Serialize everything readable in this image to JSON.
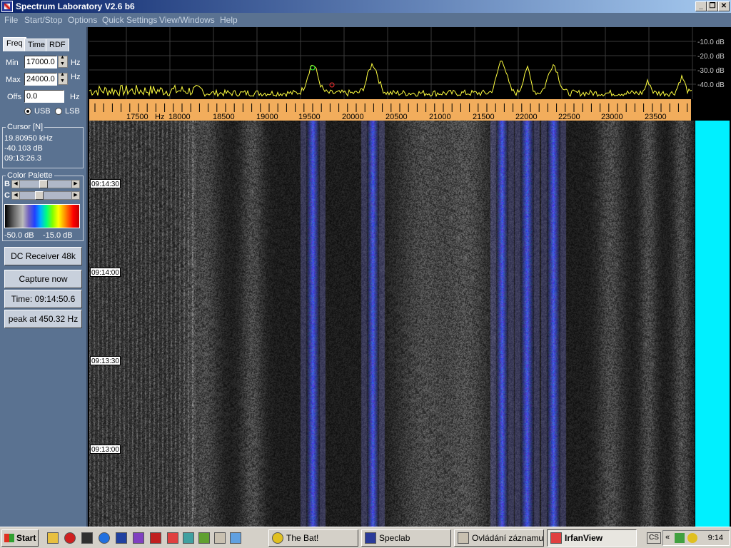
{
  "window": {
    "title": "Spectrum Laboratory V2.6 b6"
  },
  "menu": [
    "File",
    "Start/Stop",
    "Options",
    "Quick Settings",
    "View/Windows",
    "Help"
  ],
  "tabs": [
    "Freq",
    "Time",
    "RDF"
  ],
  "freq": {
    "min_label": "Min",
    "min_value": "17000.0",
    "min_unit": "Hz",
    "max_label": "Max",
    "max_value": "24000.0",
    "max_unit": "Hz",
    "offs_label": "Offs",
    "offs_value": "0.0",
    "offs_unit": "Hz",
    "usb_label": "USB",
    "lsb_label": "LSB"
  },
  "cursor": {
    "title": "Cursor [N]",
    "freq": "19.80950 kHz",
    "level": "-40.103 dB",
    "time": "09:13:26.3"
  },
  "palette": {
    "title": "Color Palette",
    "b_label": "B",
    "c_label": "C",
    "b_level": 0.45,
    "c_level": 0.35,
    "min_db": "-50.0 dB",
    "max_db": "-15.0 dB"
  },
  "buttons": {
    "receiver": "DC Receiver 48k",
    "capture": "Capture now",
    "time": "Time:  09:14:50.6",
    "peak": "peak at 450.32 Hz"
  },
  "spectrum": {
    "db_labels": [
      "-10.0 dB",
      "-20.0 dB",
      "-30.0 dB",
      "-40.0 dB"
    ]
  },
  "freq_axis": {
    "unit": "Hz",
    "labels": [
      "17500",
      "18000",
      "18500",
      "19000",
      "19500",
      "20000",
      "20500",
      "21000",
      "21500",
      "22000",
      "22500",
      "23000",
      "23500"
    ]
  },
  "waterfall": {
    "timestamps": [
      "09:14:30",
      "09:14:00",
      "09:13:30",
      "09:13:00"
    ]
  },
  "taskbar": {
    "start": "Start",
    "tasks": [
      "The Bat!",
      "Speclab",
      "Ovládání záznamu",
      "IrfanView"
    ],
    "active_task": "IrfanView",
    "lang": "CS",
    "clock": "9:14"
  }
}
